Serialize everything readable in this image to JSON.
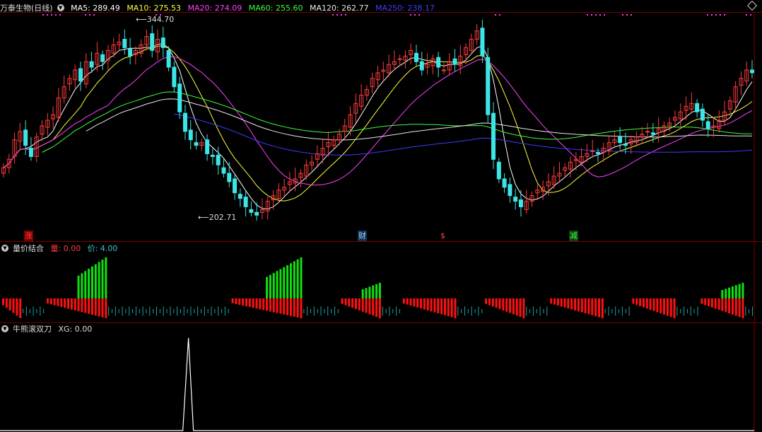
{
  "main_header": {
    "title": "万泰生物(日线)",
    "ma_items": [
      {
        "label": "MA5: 289.49",
        "color": "#ffffff"
      },
      {
        "label": "MA10: 275.53",
        "color": "#ffff3c"
      },
      {
        "label": "MA20: 274.09",
        "color": "#ff40ff"
      },
      {
        "label": "MA60: 255.60",
        "color": "#3cff3c"
      },
      {
        "label": "MA120: 262.77",
        "color": "#e8e8e8"
      },
      {
        "label": "MA250: 238.17",
        "color": "#3c3cff"
      }
    ]
  },
  "price_labels": {
    "high": "344.70",
    "low": "202.71"
  },
  "markers": [
    {
      "text": "涨",
      "color": "#ff4040",
      "bg": "#7a0000"
    },
    {
      "text": "财",
      "color": "#a0d0ff",
      "bg": "#103050"
    },
    {
      "text": "$",
      "color": "#ff4040",
      "bg": "#000000"
    },
    {
      "text": "减",
      "color": "#40ff40",
      "bg": "#104010"
    }
  ],
  "volume_header": {
    "title": "量价结合",
    "vol_label": "量: 0.00",
    "price_label": "价: 4.00",
    "vol_color": "#ff3c3c",
    "price_color": "#3cc8c8"
  },
  "signal_header": {
    "title": "牛熊滚双刀",
    "xg_label": "XG: 0.00"
  },
  "colors": {
    "up": "#ff3c3c",
    "down": "#3ce6e6",
    "bar_red": "#ff1010",
    "bar_green": "#10e010",
    "bar_cyan": "#20a0a0",
    "grid": "#7a0000",
    "dots": "#ff40ff"
  },
  "chart_data": {
    "type": "candlestick",
    "price_range": [
      195,
      352
    ],
    "high": 344.7,
    "low": 202.71,
    "ma_final": {
      "MA5": 289.49,
      "MA10": 275.53,
      "MA20": 274.09,
      "MA60": 255.6,
      "MA120": 262.77,
      "MA250": 238.17
    },
    "closes": [
      242,
      248,
      262,
      268,
      258,
      250,
      264,
      272,
      276,
      280,
      292,
      300,
      306,
      312,
      304,
      318,
      314,
      324,
      318,
      326,
      330,
      332,
      328,
      322,
      326,
      330,
      336,
      326,
      334,
      328,
      314,
      300,
      282,
      268,
      262,
      258,
      260,
      252,
      250,
      244,
      238,
      232,
      224,
      220,
      214,
      210,
      208,
      212,
      218,
      222,
      226,
      228,
      232,
      234,
      238,
      244,
      246,
      252,
      256,
      260,
      262,
      266,
      272,
      280,
      288,
      294,
      298,
      306,
      310,
      312,
      316,
      318,
      320,
      322,
      326,
      318,
      312,
      316,
      320,
      314,
      312,
      318,
      316,
      322,
      328,
      334,
      340,
      322,
      280,
      248,
      234,
      228,
      222,
      218,
      214,
      218,
      222,
      226,
      228,
      232,
      236,
      238,
      242,
      246,
      248,
      250,
      252,
      254,
      252,
      256,
      260,
      262,
      260,
      258,
      262,
      264,
      266,
      268,
      266,
      270,
      272,
      274,
      278,
      282,
      286,
      288,
      282,
      276,
      270,
      272,
      276,
      282,
      290,
      300,
      306,
      312,
      310
    ],
    "volume_pattern": {
      "red_segments": [
        [
          0,
          5
        ],
        [
          13,
          30
        ],
        [
          67,
          87
        ],
        [
          99,
          110
        ],
        [
          117,
          132
        ],
        [
          141,
          152
        ],
        [
          160,
          175
        ],
        [
          184,
          196
        ],
        [
          204,
          216
        ]
      ],
      "green_peaks": [
        4,
        30,
        87,
        110,
        216
      ]
    },
    "signal": {
      "type": "line",
      "peak_x_index": 8,
      "peak_value": 1
    }
  }
}
